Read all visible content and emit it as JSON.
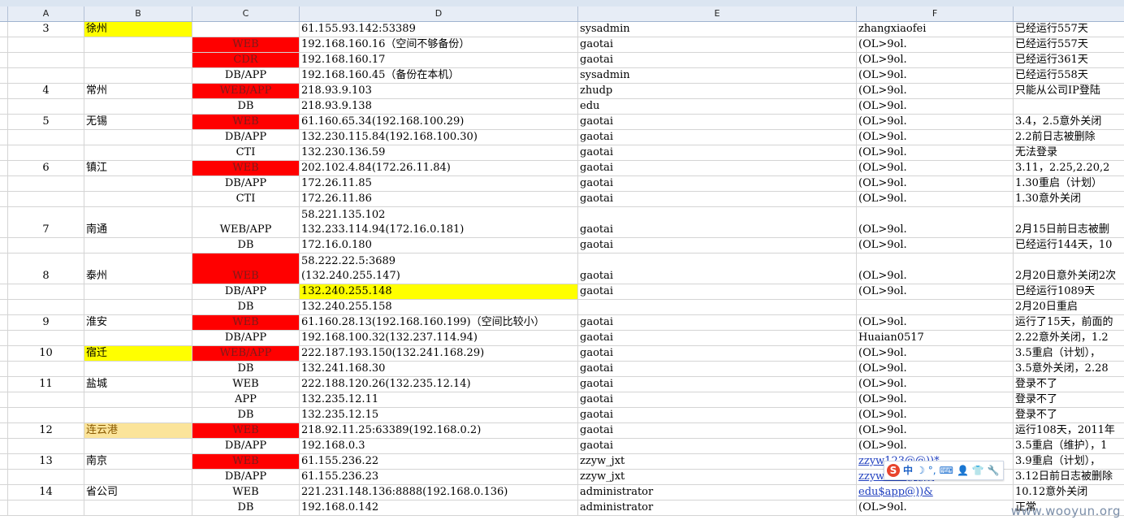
{
  "columns": [
    "A",
    "B",
    "C",
    "D",
    "E",
    "F"
  ],
  "rows": [
    {
      "a": "3",
      "b": "徐州",
      "b_style": "yellow",
      "c": "",
      "c_style": "",
      "d": [
        "61.155.93.142:53389"
      ],
      "d_style": "",
      "e": "sysadmin",
      "f": "zhangxiaofei",
      "g": "已经运行557天"
    },
    {
      "a": "",
      "b": "",
      "b_style": "",
      "c": "WEB",
      "c_style": "red",
      "d": [
        "192.168.160.16（空间不够备份）"
      ],
      "d_style": "",
      "e": "gaotai",
      "f": "(OL>9ol.",
      "g": "已经运行557天"
    },
    {
      "a": "",
      "b": "",
      "b_style": "",
      "c": "CDR",
      "c_style": "red",
      "d": [
        "192.168.160.17"
      ],
      "d_style": "",
      "e": "gaotai",
      "f": "(OL>9ol.",
      "g": "已经运行361天"
    },
    {
      "a": "",
      "b": "",
      "b_style": "",
      "c": "DB/APP",
      "c_style": "",
      "d": [
        "192.168.160.45（备份在本机）"
      ],
      "d_style": "",
      "e": "sysadmin",
      "f": "(OL>9ol.",
      "g": "已经运行558天"
    },
    {
      "a": "4",
      "b": "常州",
      "b_style": "",
      "c": "WEB/APP",
      "c_style": "red",
      "d": [
        "218.93.9.103"
      ],
      "d_style": "",
      "e": "zhudp",
      "f": "(OL>9ol.",
      "g": "只能从公司IP登陆"
    },
    {
      "a": "",
      "b": "",
      "b_style": "",
      "c": "DB",
      "c_style": "",
      "d": [
        "218.93.9.138"
      ],
      "d_style": "",
      "e": "edu",
      "f": "(OL>9ol.",
      "g": ""
    },
    {
      "a": "5",
      "b": "无锡",
      "b_style": "",
      "c": "WEB",
      "c_style": "red",
      "d": [
        "61.160.65.34(192.168.100.29)"
      ],
      "d_style": "",
      "e": "gaotai",
      "f": "(OL>9ol.",
      "g": "3.4，2.5意外关闭"
    },
    {
      "a": "",
      "b": "",
      "b_style": "",
      "c": "DB/APP",
      "c_style": "",
      "d": [
        "132.230.115.84(192.168.100.30)"
      ],
      "d_style": "",
      "e": "gaotai",
      "f": "(OL>9ol.",
      "g": "2.2前日志被删除"
    },
    {
      "a": "",
      "b": "",
      "b_style": "",
      "c": "CTI",
      "c_style": "",
      "d": [
        "132.230.136.59"
      ],
      "d_style": "",
      "e": "gaotai",
      "f": "(OL>9ol.",
      "g": "无法登录"
    },
    {
      "a": "6",
      "b": "镇江",
      "b_style": "",
      "c": "WEB",
      "c_style": "red",
      "d": [
        "202.102.4.84(172.26.11.84)"
      ],
      "d_style": "",
      "e": "gaotai",
      "f": "(OL>9ol.",
      "g": "3.11，2.25,2.20,2"
    },
    {
      "a": "",
      "b": "",
      "b_style": "",
      "c": "DB/APP",
      "c_style": "",
      "d": [
        "172.26.11.85"
      ],
      "d_style": "",
      "e": "gaotai",
      "f": "(OL>9ol.",
      "g": "1.30重启（计划）"
    },
    {
      "a": "",
      "b": "",
      "b_style": "",
      "c": "CTI",
      "c_style": "",
      "d": [
        "172.26.11.86"
      ],
      "d_style": "",
      "e": "gaotai",
      "f": "(OL>9ol.",
      "g": "1.30意外关闭"
    },
    {
      "a": "7",
      "b": "南通",
      "b_style": "",
      "c": "WEB/APP",
      "c_style": "",
      "d": [
        "58.221.135.102",
        "132.233.114.94(172.16.0.181)"
      ],
      "d_style": "",
      "e": "gaotai",
      "f": "(OL>9ol.",
      "g": "2月15日前日志被删"
    },
    {
      "a": "",
      "b": "",
      "b_style": "",
      "c": "DB",
      "c_style": "",
      "d": [
        "172.16.0.180"
      ],
      "d_style": "",
      "e": "gaotai",
      "f": "(OL>9ol.",
      "g": "已经运行144天，10"
    },
    {
      "a": "8",
      "b": "泰州",
      "b_style": "",
      "c": "WEB",
      "c_style": "red",
      "d": [
        "58.222.22.5:3689",
        "(132.240.255.147)"
      ],
      "d_style": "",
      "e": "gaotai",
      "f": "(OL>9ol.",
      "g": "2月20日意外关闭2次"
    },
    {
      "a": "",
      "b": "",
      "b_style": "",
      "c": "DB/APP",
      "c_style": "",
      "d": [
        "132.240.255.148"
      ],
      "d_style": "yellow",
      "e": "gaotai",
      "f": "(OL>9ol.",
      "g": "已经运行1089天"
    },
    {
      "a": "",
      "b": "",
      "b_style": "",
      "c": "DB",
      "c_style": "",
      "d": [
        "132.240.255.158"
      ],
      "d_style": "",
      "e": "",
      "f": "",
      "g": "2月20日重启"
    },
    {
      "a": "9",
      "b": "淮安",
      "b_style": "",
      "c": "WEB",
      "c_style": "red",
      "d": [
        "61.160.28.13(192.168.160.199)（空间比较小）"
      ],
      "d_style": "",
      "e": "gaotai",
      "f": "(OL>9ol.",
      "g": "运行了15天，前面的"
    },
    {
      "a": "",
      "b": "",
      "b_style": "",
      "c": "DB/APP",
      "c_style": "",
      "d": [
        "192.168.100.32(132.237.114.94)"
      ],
      "d_style": "",
      "e": "gaotai",
      "f": "Huaian0517",
      "g": "2.22意外关闭，1.2"
    },
    {
      "a": "10",
      "b": "宿迁",
      "b_style": "yellow",
      "c": "WEB/APP",
      "c_style": "red",
      "d": [
        "222.187.193.150(132.241.168.29)"
      ],
      "d_style": "",
      "e": "gaotai",
      "f": "(OL>9ol.",
      "g": "3.5重启（计划），"
    },
    {
      "a": "",
      "b": "",
      "b_style": "",
      "c": "DB",
      "c_style": "",
      "d": [
        "132.241.168.30"
      ],
      "d_style": "",
      "e": "gaotai",
      "f": "(OL>9ol.",
      "g": "3.5意外关闭，2.28"
    },
    {
      "a": "11",
      "b": "盐城",
      "b_style": "",
      "c": "WEB",
      "c_style": "",
      "d": [
        "222.188.120.26(132.235.12.14)"
      ],
      "d_style": "",
      "e": "gaotai",
      "f": "(OL>9ol.",
      "g": "登录不了"
    },
    {
      "a": "",
      "b": "",
      "b_style": "",
      "c": "APP",
      "c_style": "",
      "d": [
        "132.235.12.11"
      ],
      "d_style": "",
      "e": "gaotai",
      "f": "(OL>9ol.",
      "g": "登录不了"
    },
    {
      "a": "",
      "b": "",
      "b_style": "",
      "c": "DB",
      "c_style": "",
      "d": [
        "132.235.12.15"
      ],
      "d_style": "",
      "e": "gaotai",
      "f": "(OL>9ol.",
      "g": "登录不了"
    },
    {
      "a": "12",
      "b": "连云港",
      "b_style": "lyellow",
      "c": "WEB",
      "c_style": "red",
      "d": [
        "218.92.11.25:63389(192.168.0.2)"
      ],
      "d_style": "",
      "e": "gaotai",
      "f": "(OL>9ol.",
      "g": "运行108天，2011年"
    },
    {
      "a": "",
      "b": "",
      "b_style": "",
      "c": "DB/APP",
      "c_style": "",
      "d": [
        "192.168.0.3"
      ],
      "d_style": "",
      "e": "gaotai",
      "f": "(OL>9ol.",
      "g": "3.5重启（维护），1"
    },
    {
      "a": "13",
      "b": "南京",
      "b_style": "",
      "c": "WEB",
      "c_style": "red",
      "d": [
        "61.155.236.22"
      ],
      "d_style": "",
      "e": "zzyw_jxt",
      "f": "zzyw123@@))*",
      "f_link": true,
      "g": "3.9重启（计划），"
    },
    {
      "a": "",
      "b": "",
      "b_style": "",
      "c": "DB/APP",
      "c_style": "",
      "d": [
        "61.155.236.23"
      ],
      "d_style": "",
      "e": "zzyw_jxt",
      "f": "zzyw123@@))",
      "f_link": true,
      "g": "3.12日前日志被删除"
    },
    {
      "a": "14",
      "b": "省公司",
      "b_style": "",
      "c": "WEB",
      "c_style": "",
      "d": [
        "221.231.148.136:8888(192.168.0.136)"
      ],
      "d_style": "",
      "e": "administrator",
      "f": "edu$app@))&",
      "f_link": true,
      "g": "10.12意外关闭"
    },
    {
      "a": "",
      "b": "",
      "b_style": "",
      "c": "DB",
      "c_style": "",
      "d": [
        "192.168.0.142"
      ],
      "d_style": "",
      "e": "administrator",
      "f": "(OL>9ol.",
      "g": "正常"
    }
  ],
  "ime_bar": {
    "logo": "S",
    "label": "中",
    "icons": [
      "moon-icon",
      "punctuation-icon",
      "keyboard-icon",
      "user-icon",
      "shirt-icon",
      "wrench-icon"
    ]
  },
  "watermark": "www.wooyun.org"
}
